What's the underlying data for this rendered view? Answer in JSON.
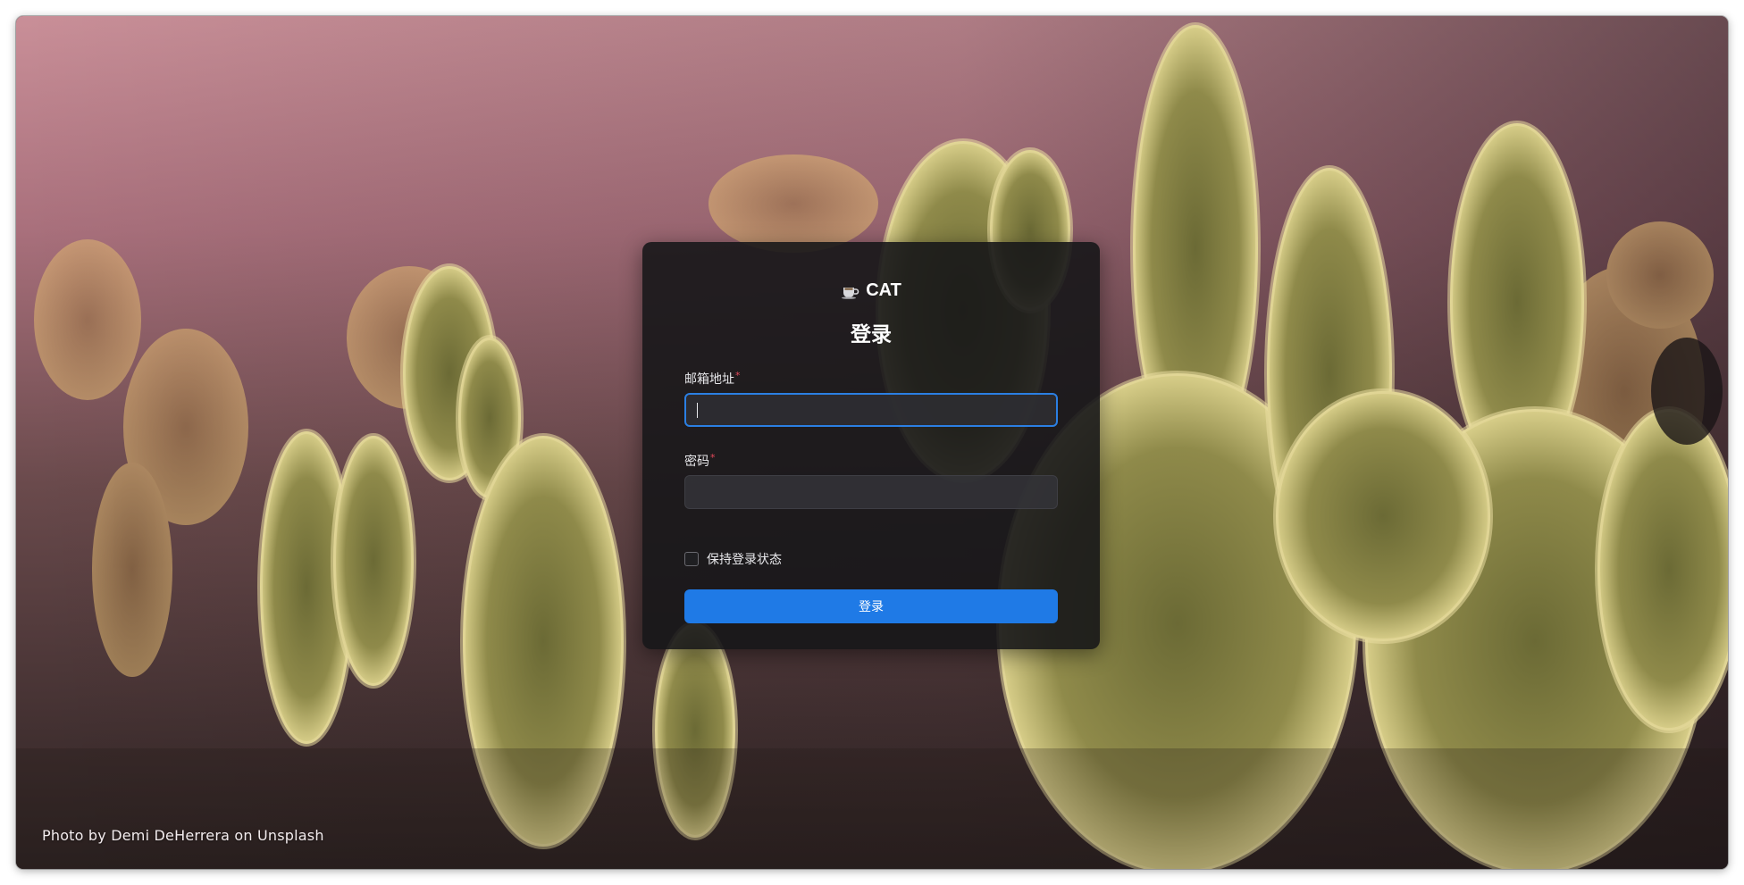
{
  "app": {
    "brand_name": "CAT",
    "brand_icon": "coffee-cup-icon"
  },
  "login": {
    "title": "登录",
    "email_label": "邮箱地址",
    "email_value": "",
    "password_label": "密码",
    "password_value": "",
    "required_mark": "*",
    "remember_label": "保持登录状态",
    "remember_checked": false,
    "submit_label": "登录"
  },
  "background": {
    "credit": "Photo by Demi DeHerrera on Unsplash"
  },
  "colors": {
    "accent": "#1f7ae6",
    "required": "#e3485a",
    "card": "#161618"
  }
}
